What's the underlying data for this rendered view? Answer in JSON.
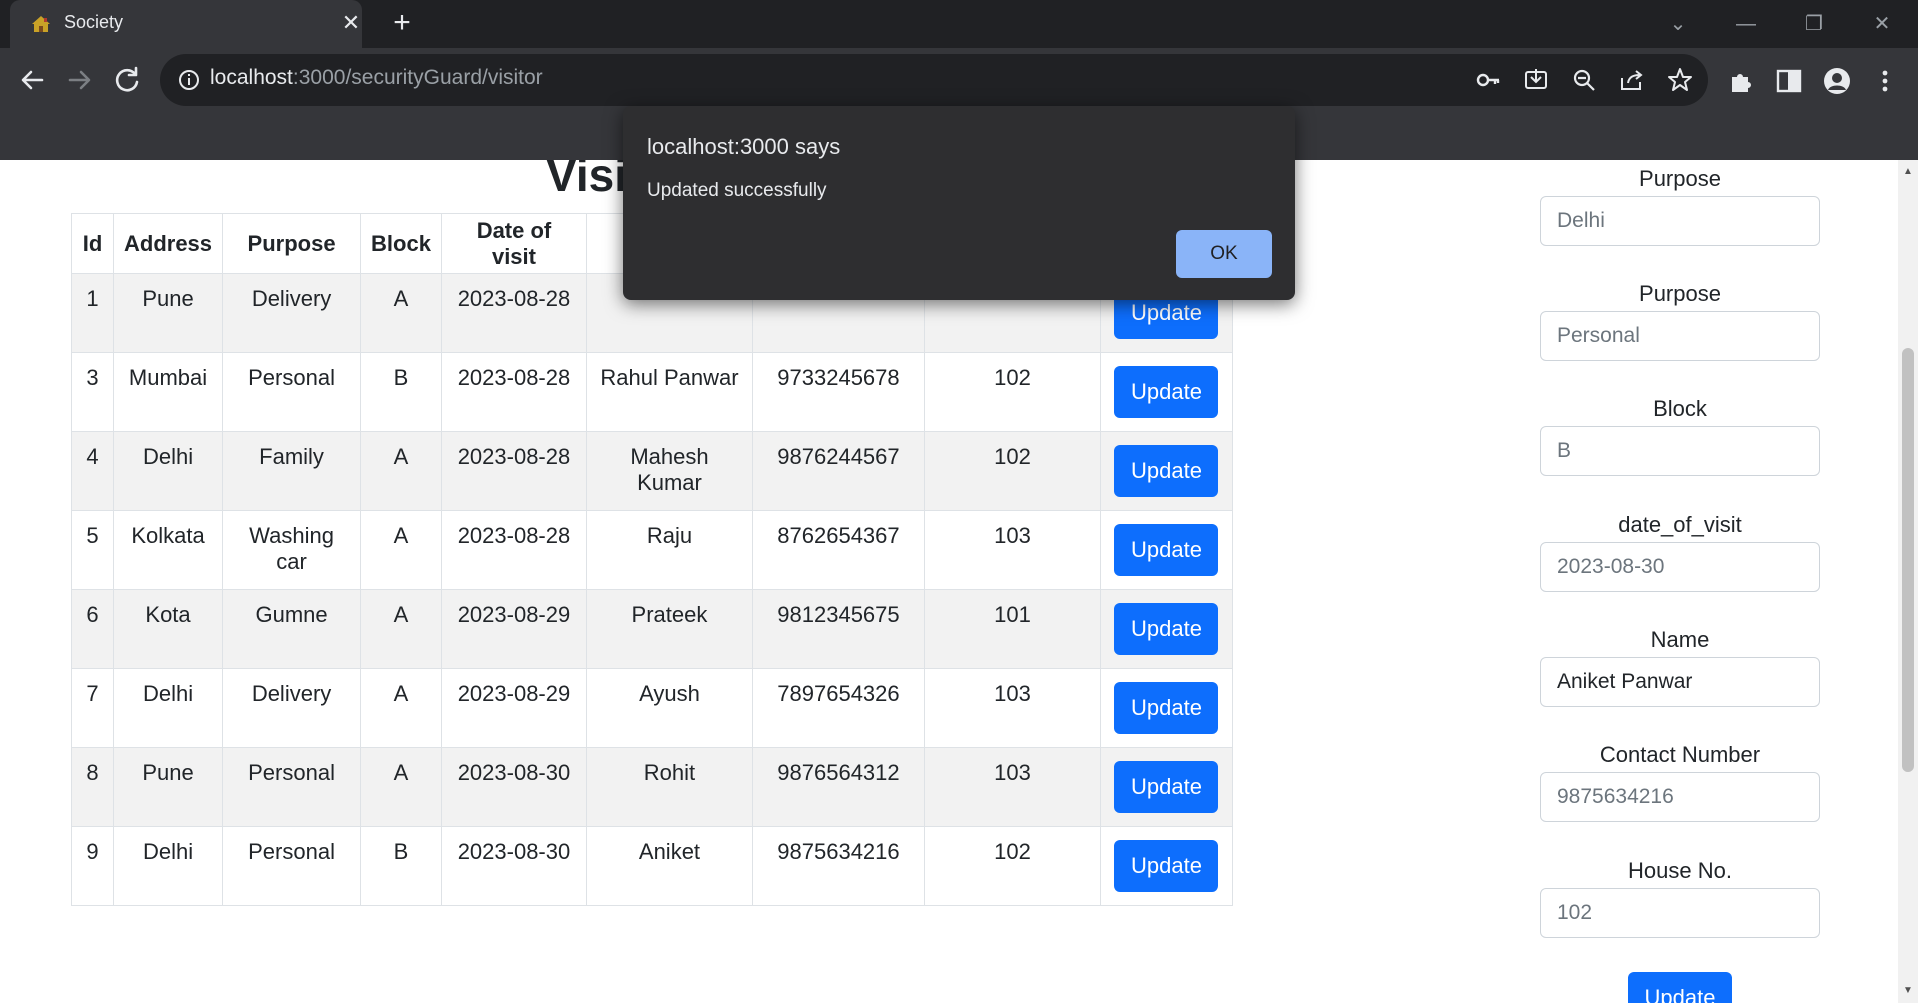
{
  "browser": {
    "tab_title": "Society",
    "url_host": "localhost",
    "url_path": ":3000/securityGuard/visitor"
  },
  "page": {
    "heading": "Visit"
  },
  "table": {
    "headers": [
      "Id",
      "Address",
      "Purpose",
      "Block",
      "Date of visit"
    ],
    "update_label": "Update",
    "rows": [
      {
        "id": "1",
        "address": "Pune",
        "purpose": "Delivery",
        "block": "A",
        "date": "2023-08-28",
        "name": "",
        "contact": "",
        "house": ""
      },
      {
        "id": "3",
        "address": "Mumbai",
        "purpose": "Personal",
        "block": "B",
        "date": "2023-08-28",
        "name": "Rahul Panwar",
        "contact": "9733245678",
        "house": "102"
      },
      {
        "id": "4",
        "address": "Delhi",
        "purpose": "Family",
        "block": "A",
        "date": "2023-08-28",
        "name": "Mahesh Kumar",
        "contact": "9876244567",
        "house": "102"
      },
      {
        "id": "5",
        "address": "Kolkata",
        "purpose": "Washing car",
        "block": "A",
        "date": "2023-08-28",
        "name": "Raju",
        "contact": "8762654367",
        "house": "103"
      },
      {
        "id": "6",
        "address": "Kota",
        "purpose": "Gumne",
        "block": "A",
        "date": "2023-08-29",
        "name": "Prateek",
        "contact": "9812345675",
        "house": "101"
      },
      {
        "id": "7",
        "address": "Delhi",
        "purpose": "Delivery",
        "block": "A",
        "date": "2023-08-29",
        "name": "Ayush",
        "contact": "7897654326",
        "house": "103"
      },
      {
        "id": "8",
        "address": "Pune",
        "purpose": "Personal",
        "block": "A",
        "date": "2023-08-30",
        "name": "Rohit",
        "contact": "9876564312",
        "house": "103"
      },
      {
        "id": "9",
        "address": "Delhi",
        "purpose": "Personal",
        "block": "B",
        "date": "2023-08-30",
        "name": "Aniket",
        "contact": "9875634216",
        "house": "102"
      }
    ]
  },
  "form": {
    "address_label": "Purpose",
    "address_value": "Delhi",
    "purpose_label": "Purpose",
    "purpose_value": "Personal",
    "block_label": "Block",
    "block_value": "B",
    "date_label": "date_of_visit",
    "date_value": "2023-08-30",
    "name_label": "Name",
    "name_value": "Aniket Panwar",
    "contact_label": "Contact Number",
    "contact_value": "9875634216",
    "house_label": "House No.",
    "house_value": "102",
    "submit_label": "Update"
  },
  "dialog": {
    "title": "localhost:3000 says",
    "message": "Updated successfully",
    "ok_label": "OK"
  },
  "colors": {
    "primary": "#0d6efd",
    "dialog_bg": "#2e2e30",
    "dialog_button": "#8ab4f8",
    "chrome_dark": "#202124",
    "chrome_toolbar": "#35363a"
  },
  "icons": [
    "favicon-house-icon",
    "close-icon",
    "plus-icon",
    "back-arrow-icon",
    "forward-arrow-icon",
    "reload-icon",
    "info-icon",
    "key-icon",
    "install-icon",
    "zoom-out-icon",
    "share-icon",
    "star-icon",
    "extensions-icon",
    "side-panel-icon",
    "profile-icon",
    "menu-dots-icon"
  ]
}
